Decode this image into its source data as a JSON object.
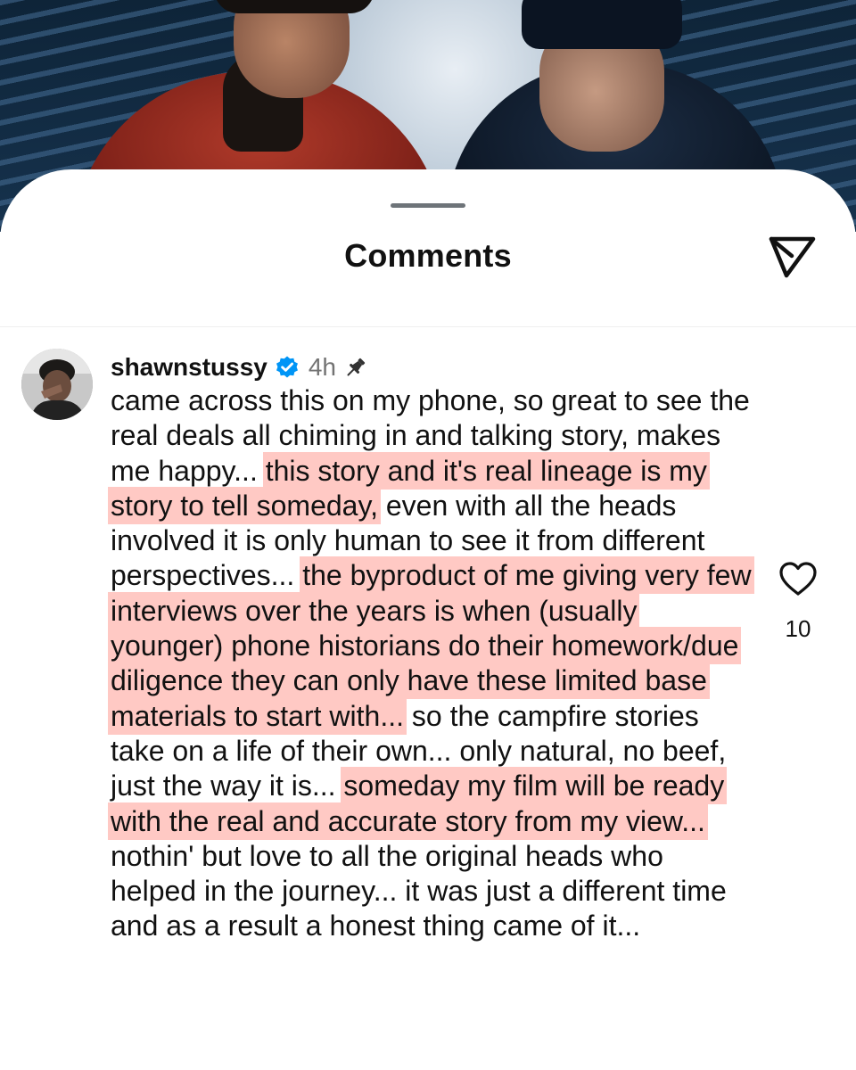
{
  "sheet": {
    "title": "Comments"
  },
  "icons": {
    "share": "paper-plane-icon",
    "like": "heart-outline-icon",
    "verified": "verified-badge-icon",
    "pin": "pin-icon"
  },
  "colors": {
    "highlight": "#ffc9c4",
    "verified_blue": "#0095f6",
    "muted_text": "#737373"
  },
  "comment": {
    "username": "shawnstussy",
    "time": "4h",
    "like_count": "10",
    "segments": [
      {
        "text": "came across this on my phone, so great to see the real deals all chiming in and talking story, makes me happy... ",
        "highlight": false
      },
      {
        "text": "this story and it's real lineage is my story to tell someday,",
        "highlight": true
      },
      {
        "text": " even with all the heads involved it is only human to see it from different perspectives... ",
        "highlight": false
      },
      {
        "text": "the byproduct of me giving very few interviews over the years is when (usually younger) phone historians do their homework/due diligence they can only have these limited base materials to start with...",
        "highlight": true
      },
      {
        "text": " so the campfire stories take on a life of their own... only natural, no beef, just the way it is... ",
        "highlight": false
      },
      {
        "text": "someday my film will be ready with the real and accurate story from my view...",
        "highlight": true
      },
      {
        "text": " nothin' but love to all the original heads who helped in the journey... it was just a different time and as a result a honest thing came of it...",
        "highlight": false
      }
    ]
  }
}
